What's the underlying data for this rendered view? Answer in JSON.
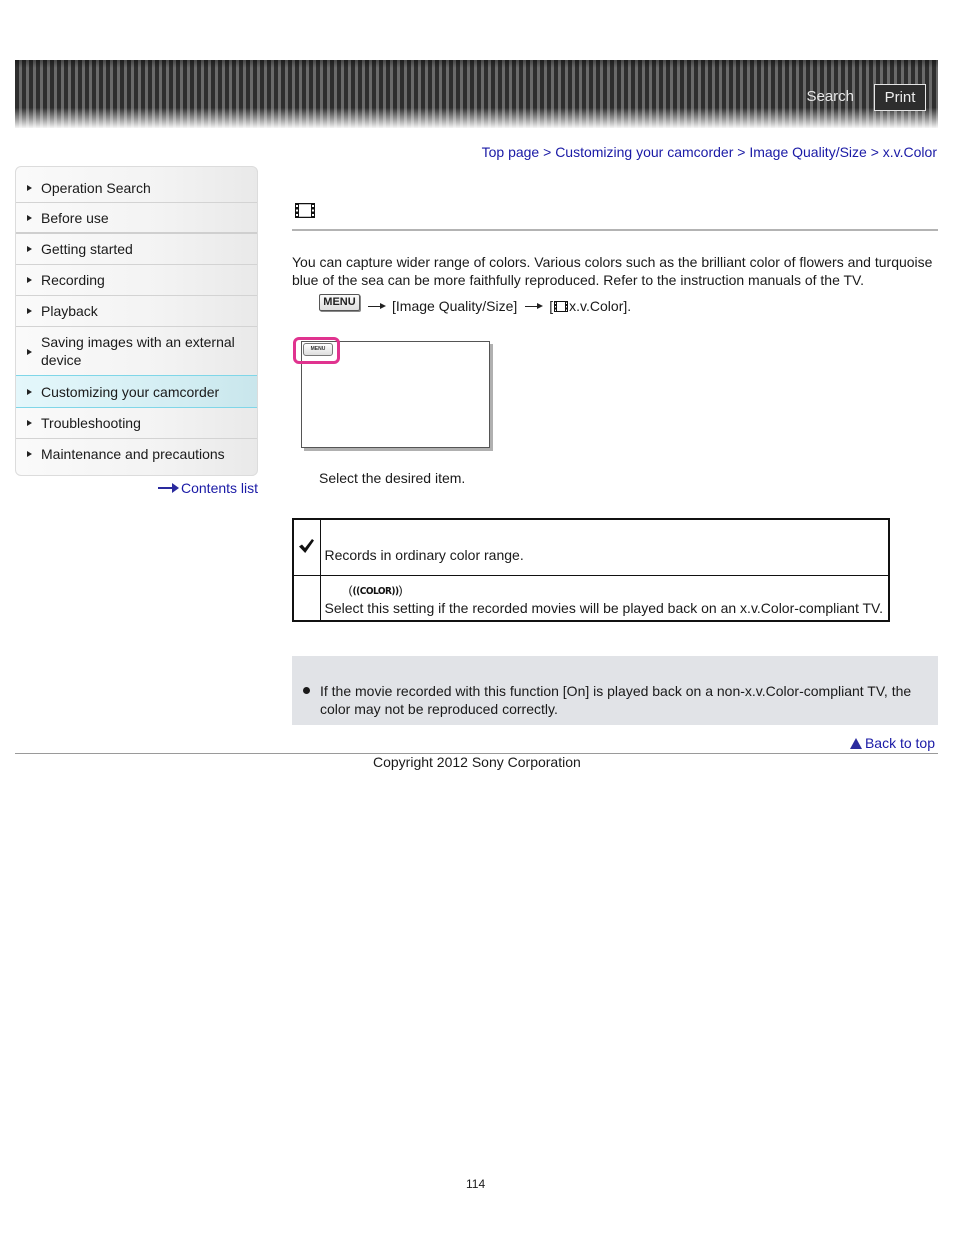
{
  "header": {
    "search_label": "Search",
    "print_label": "Print"
  },
  "breadcrumb": {
    "items": [
      "Top page",
      "Customizing your camcorder",
      "Image Quality/Size",
      "x.v.Color"
    ],
    "separator": ">"
  },
  "sidebar": {
    "items": [
      {
        "label": "Operation Search",
        "active": false
      },
      {
        "label": "Before use",
        "active": false
      },
      {
        "label": "Getting started",
        "active": false
      },
      {
        "label": "Recording",
        "active": false
      },
      {
        "label": "Playback",
        "active": false
      },
      {
        "label": "Saving images with an external device",
        "active": false
      },
      {
        "label": "Customizing your camcorder",
        "active": true
      },
      {
        "label": "Troubleshooting",
        "active": false
      },
      {
        "label": "Maintenance and precautions",
        "active": false
      }
    ],
    "active_color": "#d2edf2",
    "contents_list_label": "Contents list"
  },
  "main": {
    "title_icon": "movie-film-icon",
    "intro": "You can capture wider range of colors. Various colors such as the brilliant color of flowers and turquoise blue of the sea can be more faithfully reproduced. Refer to the instruction manuals of the TV.",
    "menu_path": {
      "menu_icon_label": "MENU",
      "step1": "[Image Quality/Size]",
      "step2_prefix": "[",
      "step2": "x.v.Color].",
      "arrow_icon": "right-arrow-icon"
    },
    "illustration": {
      "menu_label": "MENU",
      "highlight_color": "#e0338f"
    },
    "select_text": "Select the desired item.",
    "options": [
      {
        "icon": "check-icon",
        "name": "",
        "description": "Records in ordinary color range."
      },
      {
        "icon": "",
        "name_paren_open": "(",
        "name_badge": "((COLOR))",
        "name_paren_close": ")",
        "description": "Select this setting if the recorded movies will be played back on an x.v.Color-compliant TV."
      }
    ],
    "notes": [
      "If the movie recorded with this function [On] is played back on a non-x.v.Color-compliant TV, the color may not be reproduced correctly."
    ],
    "note_bg": "#e1e3e7"
  },
  "footer": {
    "back_to_top": "Back to top",
    "copyright": "Copyright 2012 Sony Corporation",
    "page_number": "114"
  },
  "colors": {
    "link": "#1a1aa6"
  }
}
